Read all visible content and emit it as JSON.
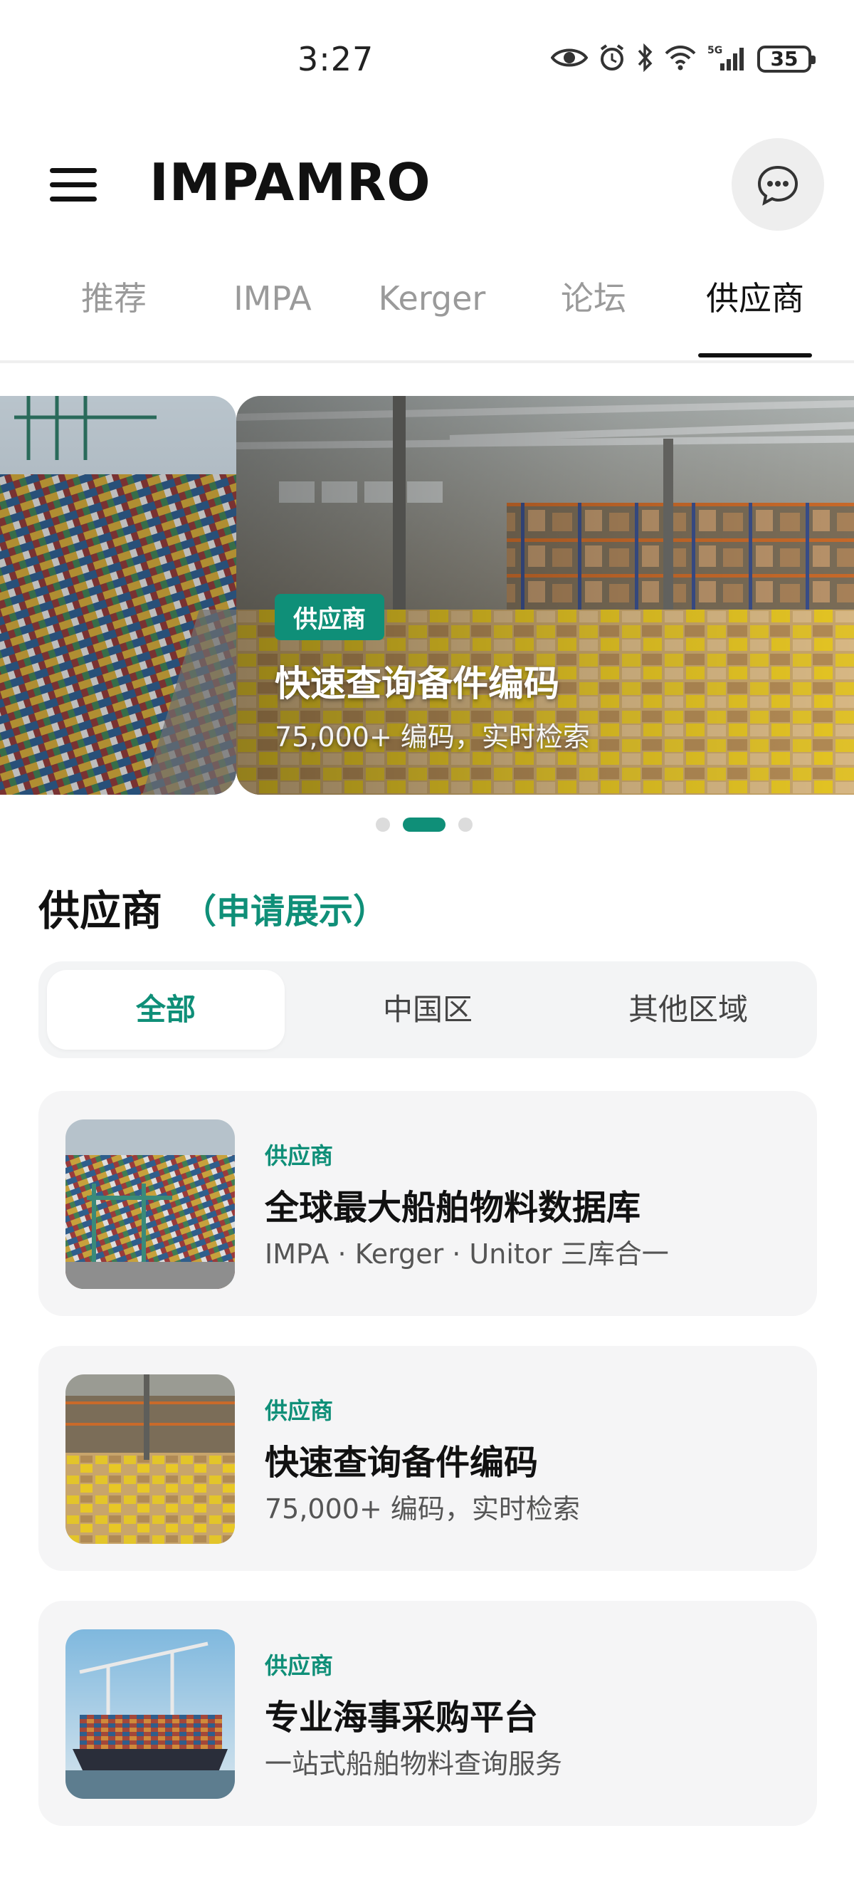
{
  "status": {
    "time": "3:27",
    "battery": "35",
    "network": "5G"
  },
  "app": {
    "title": "IMPAMRO"
  },
  "tabs": [
    {
      "label": "推荐"
    },
    {
      "label": "IMPA"
    },
    {
      "label": "Kerger"
    },
    {
      "label": "论坛"
    },
    {
      "label": "供应商"
    }
  ],
  "active_tab": "供应商",
  "carousel": {
    "active_slide": 2,
    "slide_count": 3,
    "current": {
      "badge": "供应商",
      "title": "快速查询备件编码",
      "subtitle": "75,000+ 编码，实时检索"
    }
  },
  "section": {
    "title": "供应商",
    "apply": "（申请展示）"
  },
  "segments": [
    {
      "label": "全部"
    },
    {
      "label": "中国区"
    },
    {
      "label": "其他区域"
    }
  ],
  "active_segment": "全部",
  "cards": [
    {
      "tag": "供应商",
      "title": "全球最大船舶物料数据库",
      "subtitle": "IMPA · Kerger · Unitor 三库合一"
    },
    {
      "tag": "供应商",
      "title": "快速查询备件编码",
      "subtitle": "75,000+ 编码，实时检索"
    },
    {
      "tag": "供应商",
      "title": "专业海事采购平台",
      "subtitle": "一站式船舶物料查询服务"
    }
  ],
  "colors": {
    "accent": "#0f8f78",
    "text": "#111111",
    "muted": "#9a9a9a",
    "card_bg": "#f5f5f6"
  },
  "icons": {
    "menu": "hamburger-icon",
    "chat": "chat-bubble-icon"
  }
}
